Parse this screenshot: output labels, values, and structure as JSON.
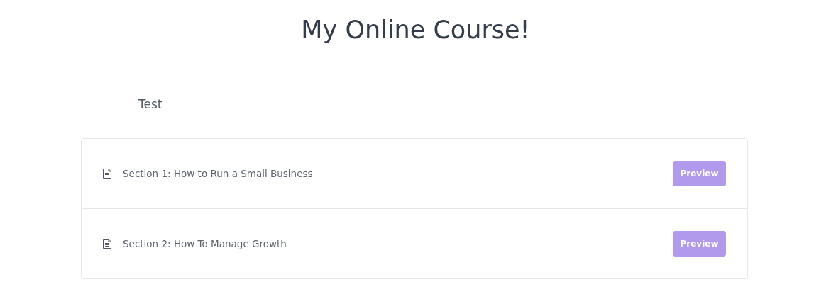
{
  "title": "My Online Course!",
  "description": "Test",
  "sections": [
    {
      "label": "Section 1: How to Run a Small Business",
      "button": "Preview"
    },
    {
      "label": "Section 2: How To Manage Growth",
      "button": "Preview"
    }
  ]
}
